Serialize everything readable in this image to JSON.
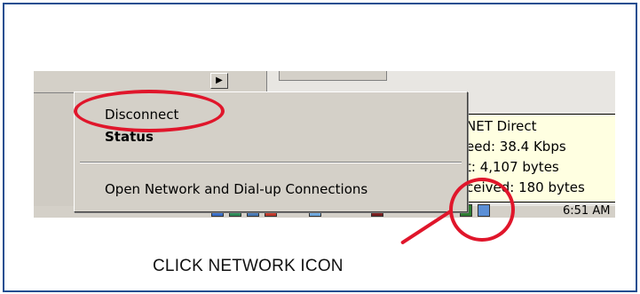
{
  "context_menu": {
    "items": [
      {
        "label": "Disconnect",
        "bold": false
      },
      {
        "label": "Status",
        "bold": true
      },
      {
        "label": "Open Network and Dial-up Connections",
        "bold": false
      }
    ]
  },
  "tooltip": {
    "lines": [
      "NET Direct",
      "eed: 38.4 Kbps",
      "t: 4,107 bytes",
      "ceived: 180 bytes"
    ]
  },
  "tray": {
    "clock": "6:51 AM",
    "icons": [
      "network-icon",
      "volume-icon",
      "app-icon",
      "app-icon",
      "app-icon",
      "app-icon",
      "app-icon",
      "app-icon"
    ]
  },
  "annotation": {
    "caption": "CLICK NETWORK ICON",
    "highlight_color": "#e0162b"
  },
  "colors": {
    "frame_border": "#1f4e91",
    "menu_background": "#d4d0c8",
    "tooltip_background": "#ffffe1"
  }
}
